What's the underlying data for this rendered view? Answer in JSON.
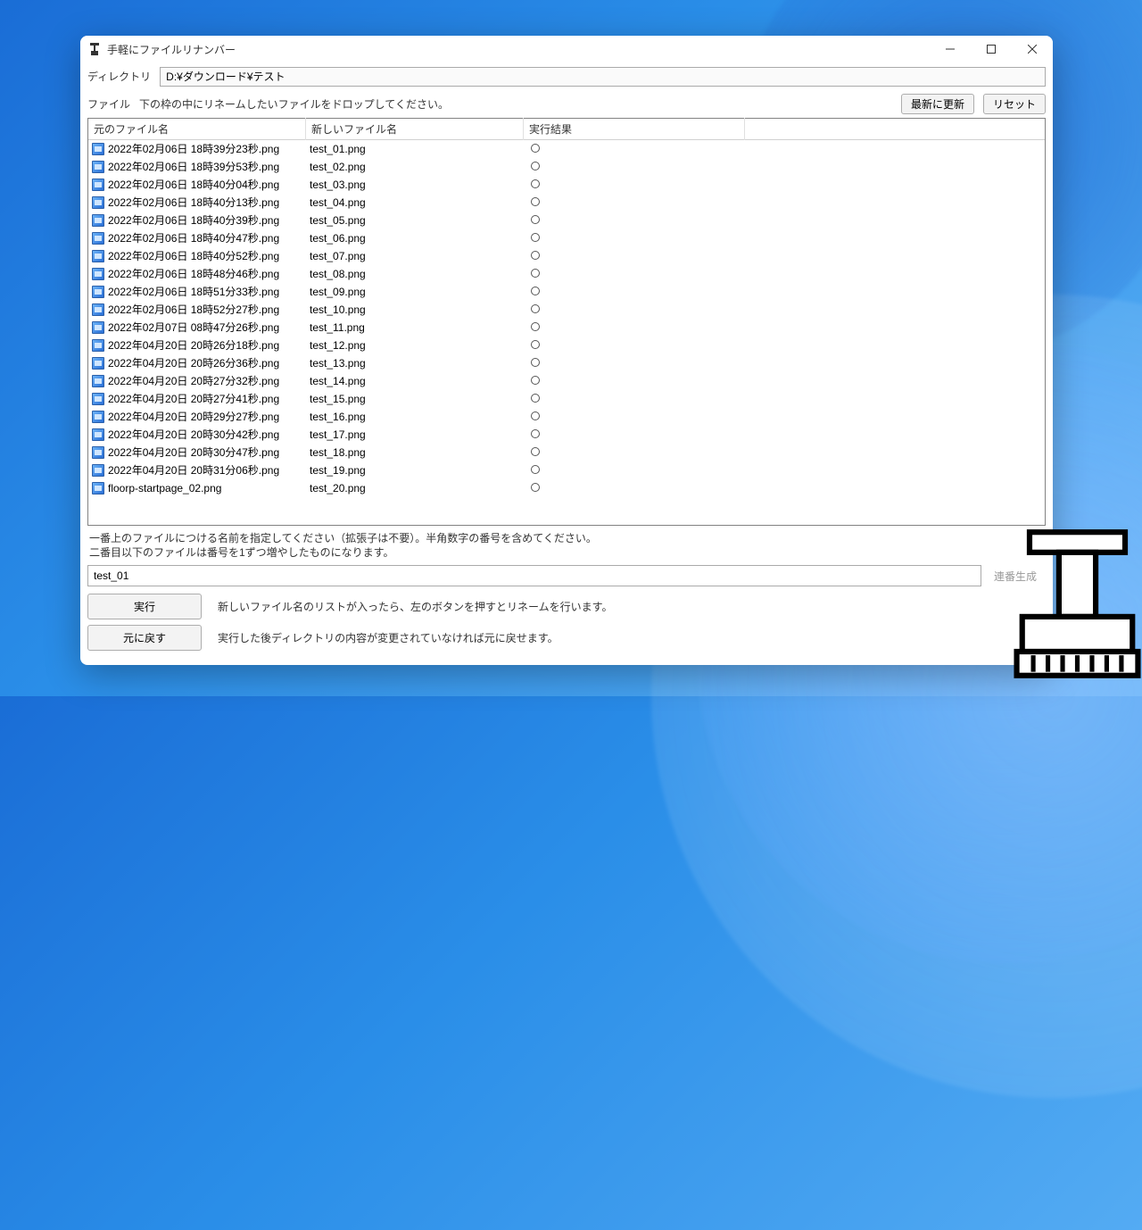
{
  "window": {
    "title": "手軽にファイルリナンバー"
  },
  "directory": {
    "label": "ディレクトリ",
    "value": "D:¥ダウンロード¥テスト"
  },
  "fileDrop": {
    "label": "ファイル",
    "text": "下の枠の中にリネームしたいファイルをドロップしてください。",
    "refresh": "最新に更新",
    "reset": "リセット"
  },
  "columns": {
    "original": "元のファイル名",
    "new": "新しいファイル名",
    "result": "実行結果"
  },
  "rows": [
    {
      "orig": "2022年02月06日 18時39分23秒.png",
      "new": "test_01.png"
    },
    {
      "orig": "2022年02月06日 18時39分53秒.png",
      "new": "test_02.png"
    },
    {
      "orig": "2022年02月06日 18時40分04秒.png",
      "new": "test_03.png"
    },
    {
      "orig": "2022年02月06日 18時40分13秒.png",
      "new": "test_04.png"
    },
    {
      "orig": "2022年02月06日 18時40分39秒.png",
      "new": "test_05.png"
    },
    {
      "orig": "2022年02月06日 18時40分47秒.png",
      "new": "test_06.png"
    },
    {
      "orig": "2022年02月06日 18時40分52秒.png",
      "new": "test_07.png"
    },
    {
      "orig": "2022年02月06日 18時48分46秒.png",
      "new": "test_08.png"
    },
    {
      "orig": "2022年02月06日 18時51分33秒.png",
      "new": "test_09.png"
    },
    {
      "orig": "2022年02月06日 18時52分27秒.png",
      "new": "test_10.png"
    },
    {
      "orig": "2022年02月07日 08時47分26秒.png",
      "new": "test_11.png"
    },
    {
      "orig": "2022年04月20日 20時26分18秒.png",
      "new": "test_12.png"
    },
    {
      "orig": "2022年04月20日 20時26分36秒.png",
      "new": "test_13.png"
    },
    {
      "orig": "2022年04月20日 20時27分32秒.png",
      "new": "test_14.png"
    },
    {
      "orig": "2022年04月20日 20時27分41秒.png",
      "new": "test_15.png"
    },
    {
      "orig": "2022年04月20日 20時29分27秒.png",
      "new": "test_16.png"
    },
    {
      "orig": "2022年04月20日 20時30分42秒.png",
      "new": "test_17.png"
    },
    {
      "orig": "2022年04月20日 20時30分47秒.png",
      "new": "test_18.png"
    },
    {
      "orig": "2022年04月20日 20時31分06秒.png",
      "new": "test_19.png"
    },
    {
      "orig": "floorp-startpage_02.png",
      "new": "test_20.png"
    }
  ],
  "help": {
    "line1": "一番上のファイルにつける名前を指定してください（拡張子は不要）。半角数字の番号を含めてください。",
    "line2": "二番目以下のファイルは番号を1ずつ増やしたものになります。"
  },
  "nameInput": {
    "value": "test_01",
    "generate": "連番生成"
  },
  "actions": {
    "execute": "実行",
    "executeDesc": "新しいファイル名のリストが入ったら、左のボタンを押すとリネームを行います。",
    "revert": "元に戻す",
    "revertDesc": "実行した後ディレクトリの内容が変更されていなければ元に戻せます。"
  }
}
